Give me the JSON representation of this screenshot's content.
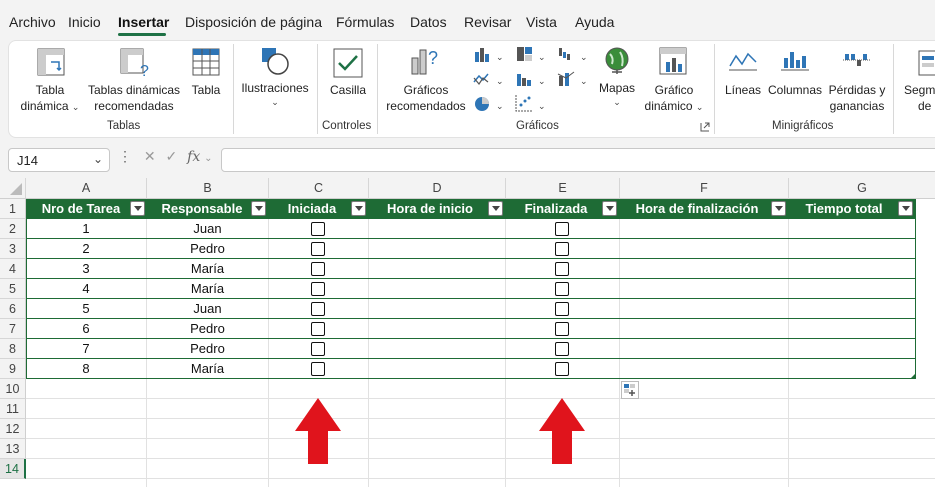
{
  "menu": {
    "items": [
      "Archivo",
      "Inicio",
      "Insertar",
      "Disposición de página",
      "Fórmulas",
      "Datos",
      "Revisar",
      "Vista",
      "Ayuda"
    ],
    "active": "Insertar"
  },
  "ribbon": {
    "tabla_dinamica": [
      "Tabla",
      "dinámica"
    ],
    "tablas_dinamicas_recomendadas": [
      "Tablas dinámicas",
      "recomendadas"
    ],
    "tabla": "Tabla",
    "ilustraciones": "Ilustraciones",
    "casilla": "Casilla",
    "graficos_recomendados": [
      "Gráficos",
      "recomendados"
    ],
    "mapas": "Mapas",
    "grafico_dinamico": [
      "Gráfico",
      "dinámico"
    ],
    "lineas": "Líneas",
    "columnas": "Columnas",
    "perdidas_ganancias": [
      "Pérdidas y",
      "ganancias"
    ],
    "segmentacion": [
      "Segme",
      "de"
    ],
    "groups": {
      "tablas": "Tablas",
      "controles": "Controles",
      "graficos": "Gráficos",
      "minigraficos": "Minigráficos"
    }
  },
  "formula_bar": {
    "name_box": "J14",
    "fx": "fx",
    "value": ""
  },
  "columns": [
    "A",
    "B",
    "C",
    "D",
    "E",
    "F",
    "G"
  ],
  "rows": [
    "1",
    "2",
    "3",
    "4",
    "5",
    "6",
    "7",
    "8",
    "9",
    "10",
    "11",
    "12",
    "13",
    "14"
  ],
  "selected_row": "14",
  "table": {
    "headers": [
      "Nro de Tarea",
      "Responsable",
      "Iniciada",
      "Hora de inicio",
      "Finalizada",
      "Hora de finalización",
      "Tiempo total"
    ],
    "rows": [
      {
        "nro": "1",
        "responsable": "Juan"
      },
      {
        "nro": "2",
        "responsable": "Pedro"
      },
      {
        "nro": "3",
        "responsable": "María"
      },
      {
        "nro": "4",
        "responsable": "María"
      },
      {
        "nro": "5",
        "responsable": "Juan"
      },
      {
        "nro": "6",
        "responsable": "Pedro"
      },
      {
        "nro": "7",
        "responsable": "Pedro"
      },
      {
        "nro": "8",
        "responsable": "María"
      }
    ],
    "header_color": "#1e6b35"
  },
  "colors": {
    "accent": "#1e7145",
    "arrow": "#e0141c"
  }
}
